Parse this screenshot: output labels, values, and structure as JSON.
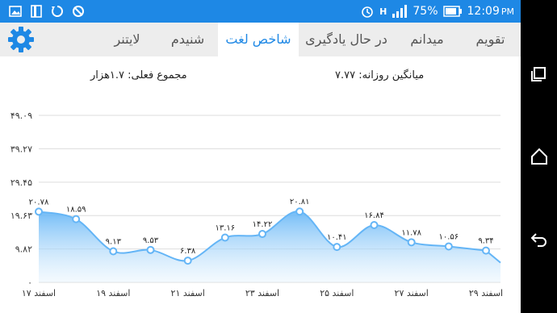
{
  "status": {
    "battery_percent": "75%",
    "time": "12:09",
    "ampm": "PM",
    "net_label": "H"
  },
  "tabs": [
    {
      "label": "تقویم",
      "active": false
    },
    {
      "label": "میدانم",
      "active": false
    },
    {
      "label": "در حال یادگیری",
      "active": false
    },
    {
      "label": "شاخص لغت",
      "active": true
    },
    {
      "label": "شنیدم",
      "active": false
    },
    {
      "label": "لایتنر",
      "active": false
    }
  ],
  "stats": {
    "daily_average": "میانگین روزانه: ۷.۷۷",
    "total": "مجموع فعلی: ۱.۷هزار"
  },
  "colors": {
    "accent": "#1e88e5",
    "line": "#64b5f6",
    "fill": "#bbdefb"
  },
  "chart_data": {
    "type": "area",
    "title": "",
    "xlabel": "",
    "ylabel": "",
    "ylim": [
      0,
      49.09
    ],
    "grid": true,
    "y_ticks": [
      {
        "value": 0,
        "label": "۰"
      },
      {
        "value": 9.82,
        "label": "۹.۸۲"
      },
      {
        "value": 19.63,
        "label": "۱۹.۶۳"
      },
      {
        "value": 29.45,
        "label": "۲۹.۴۵"
      },
      {
        "value": 39.27,
        "label": "۳۹.۲۷"
      },
      {
        "value": 49.09,
        "label": "۴۹.۰۹"
      }
    ],
    "x": [
      17,
      18,
      19,
      20,
      21,
      22,
      23,
      24,
      25,
      26,
      27,
      28,
      29
    ],
    "x_tick_labels": [
      {
        "x": 17,
        "label": "۱۷ اسفند"
      },
      {
        "x": 19,
        "label": "۱۹ اسفند"
      },
      {
        "x": 21,
        "label": "۲۱ اسفند"
      },
      {
        "x": 23,
        "label": "۲۳ اسفند"
      },
      {
        "x": 25,
        "label": "۲۵ اسفند"
      },
      {
        "x": 27,
        "label": "۲۷ اسفند"
      },
      {
        "x": 29,
        "label": "۲۹ اسفند"
      }
    ],
    "series": [
      {
        "values": [
          20.78,
          18.59,
          9.13,
          9.53,
          6.38,
          13.16,
          14.22,
          20.81,
          10.41,
          16.84,
          11.78,
          10.56,
          9.34
        ],
        "labels": [
          "۲۰.۷۸",
          "۱۸.۵۹",
          "۹.۱۳",
          "۹.۵۳",
          "۶.۳۸",
          "۱۳.۱۶",
          "۱۴.۲۲",
          "۲۰.۸۱",
          "۱۰.۴۱",
          "۱۶.۸۴",
          "۱۱.۷۸",
          "۱۰.۵۶",
          "۹.۳۴"
        ]
      }
    ]
  }
}
